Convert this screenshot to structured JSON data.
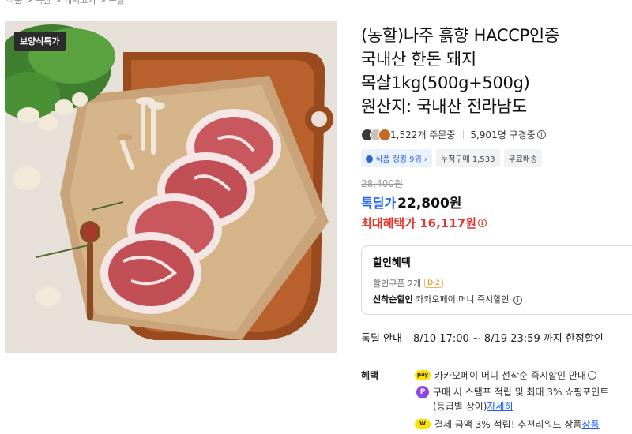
{
  "breadcrumb": "식품 > 축산 > 돼지고기 > 목살",
  "promo_badge": "보양식특가",
  "title_lines": [
    "(농할)나주 흙향 HACCP인증",
    "국내산 한돈 돼지",
    "목살1kg(500g+500g)",
    "원산지: 국내산 전라남도"
  ],
  "stats": {
    "orders": "1,522개 주문중",
    "reviews": "5,901명 구경중"
  },
  "chips": [
    "식품 랭킹 9위 ›",
    "누적구매 1,533",
    "무료배송"
  ],
  "price": {
    "original": "28,400원",
    "deal_label": "톡딜가",
    "deal_value": "22,800원",
    "max_benefit": "최대혜택가 16,117원"
  },
  "discount": {
    "title": "할인혜택",
    "coupon": "할인쿠폰 2개",
    "dday": "D-2",
    "first_label": "선착순할인",
    "first_desc": " 카카오페이 머니 즉시할인"
  },
  "notice": {
    "label": "톡딜 안내",
    "value": "8/10 17:00 ~ 8/19 23:59 까지 한정할인"
  },
  "benefits": {
    "label": "혜택",
    "item1": "카카오페이 머니 선착순 즉시할인 안내",
    "item2": "구매 시 스탬프 적립 및 최대 3% 쇼핑포인트",
    "item2b_text": "(등급별 상이) ",
    "item2b_link": "자세히",
    "item3": "결제 금액 3% 적립! 추천리워드 상품 ",
    "item3_link": "상품",
    "pay_icon": "pay",
    "p_icon": "P",
    "w_icon": "W"
  },
  "colors": {
    "deal_blue": "#1a5cff",
    "max_red": "#e8332c",
    "dday_orange": "#f08a00"
  }
}
